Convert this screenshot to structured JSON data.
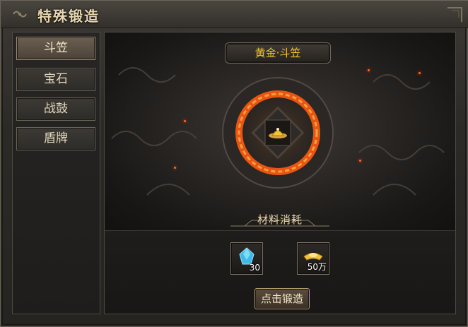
{
  "window": {
    "title": "特殊锻造"
  },
  "sidebar": {
    "tabs": [
      {
        "label": "斗笠",
        "active": true
      },
      {
        "label": "宝石",
        "active": false
      },
      {
        "label": "战鼓",
        "active": false
      },
      {
        "label": "盾牌",
        "active": false
      }
    ]
  },
  "item": {
    "name": "黄金·斗笠",
    "icon": "hat-icon"
  },
  "materials": {
    "title": "材料消耗",
    "items": [
      {
        "icon": "blue-gem-icon",
        "quantity": "30"
      },
      {
        "icon": "gold-ingot-icon",
        "quantity": "50万"
      }
    ]
  },
  "forge_button": {
    "label": "点击锻造"
  },
  "colors": {
    "item_name": "#f3c430",
    "fire_ring": "#ff5a12",
    "panel_border": "#6b645a"
  }
}
